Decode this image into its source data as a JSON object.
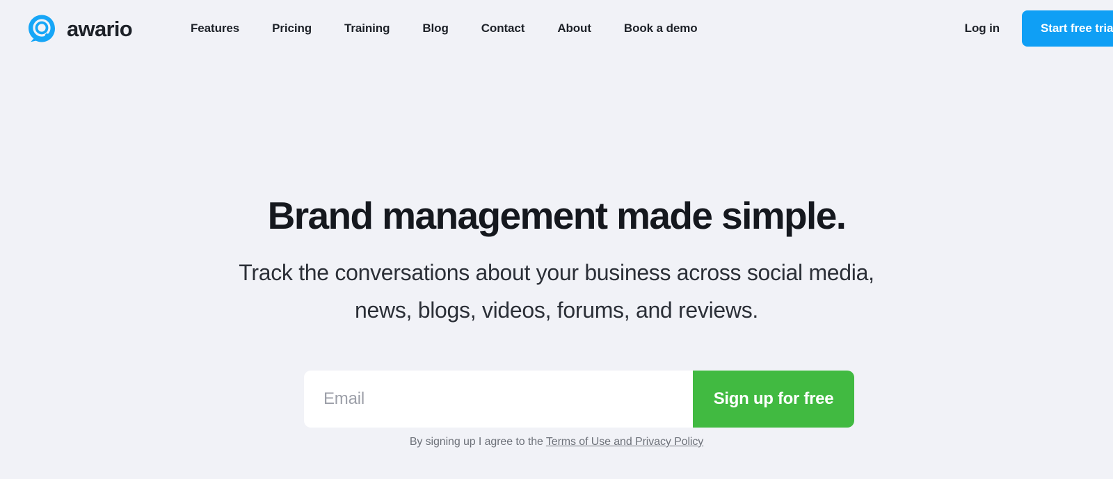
{
  "site": {
    "brand_name": "awario",
    "logo_icon": "awario-speech-bubble-search-logo",
    "accent_blue": "#0f9ff5",
    "accent_green": "#41ba41",
    "background": "#f1f2f7"
  },
  "header": {
    "nav_items": [
      {
        "label": "Features",
        "name": "nav-item-features"
      },
      {
        "label": "Pricing",
        "name": "nav-item-pricing"
      },
      {
        "label": "Training",
        "name": "nav-item-training"
      },
      {
        "label": "Blog",
        "name": "nav-item-blog"
      },
      {
        "label": "Contact",
        "name": "nav-item-contact"
      },
      {
        "label": "About",
        "name": "nav-item-about"
      },
      {
        "label": "Book a demo",
        "name": "nav-item-book-a-demo"
      }
    ],
    "login_label": "Log in",
    "trial_button_label": "Start free trial"
  },
  "hero": {
    "headline": "Brand management made simple.",
    "subheadline_line1": "Track the conversations about your business across social media,",
    "subheadline_line2": "news, blogs, videos, forums, and reviews."
  },
  "signup": {
    "email_placeholder": "Email",
    "email_value": "",
    "button_label": "Sign up for free",
    "terms_prefix": "By signing up I agree to the ",
    "terms_link_label": "Terms of Use and Privacy Policy"
  }
}
